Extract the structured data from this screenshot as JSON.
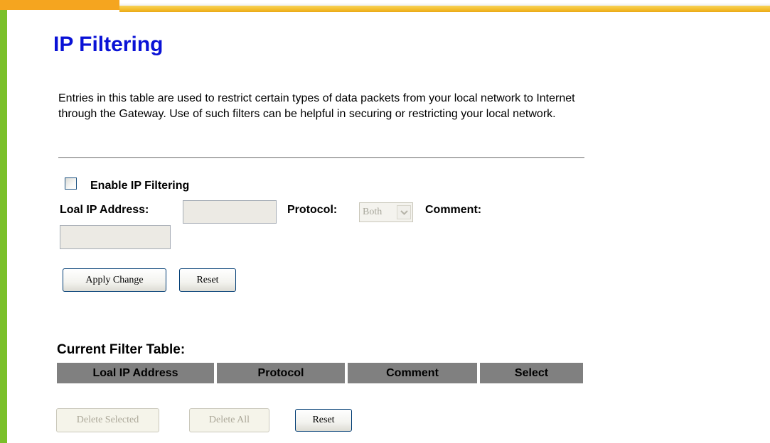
{
  "colors": {
    "title": "#0a12d6",
    "left_bar": "#7ac02a",
    "top_bar": "#f2b824",
    "table_header": "#808080"
  },
  "page": {
    "title": "IP Filtering",
    "description": "Entries in this table are used to restrict certain types of data packets from your local network to Internet through the Gateway. Use of such filters can be helpful in securing or restricting your local network."
  },
  "form": {
    "enable_label": "Enable IP Filtering",
    "enable_checked": false,
    "local_ip_label": "Loal IP Address:",
    "local_ip_value": "",
    "protocol_label": "Protocol:",
    "protocol_selected": "Both",
    "comment_label": "Comment:",
    "comment_value": "",
    "apply_button": "Apply Change",
    "reset_button": "Reset"
  },
  "table": {
    "title": "Current Filter Table:",
    "columns": [
      "Loal IP Address",
      "Protocol",
      "Comment",
      "Select"
    ],
    "rows": []
  },
  "table_actions": {
    "delete_selected": "Delete Selected",
    "delete_all": "Delete All",
    "reset": "Reset"
  }
}
